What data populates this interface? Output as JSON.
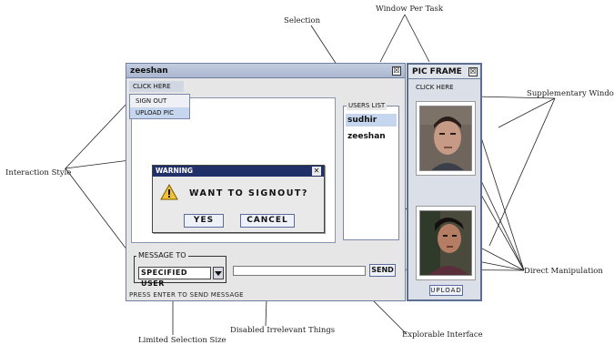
{
  "annotations": {
    "window_per_task": "Window Per Task",
    "selection": "Selection",
    "supplementary_windows": "Supplementary Windows",
    "interaction_style": "Interaction Style",
    "direct_manipulation": "Direct Manipulation",
    "limited_selection_size": "Limited Selection Size",
    "disabled_irrelevant_things": "Disabled Irrelevant Things",
    "explorable_interface": "Explorable Interface"
  },
  "main_window": {
    "title": "zeeshan",
    "close_glyph": "☒",
    "menu_label": "CLICK HERE",
    "menu_items": [
      "SIGN OUT",
      "UPLOAD PIC"
    ],
    "users_list_title": "USERS LIST",
    "users": [
      "sudhir",
      "zeeshan"
    ],
    "message_to_label": "MESSAGE TO",
    "recipient_select": "SPECIFIED USER",
    "send_label": "SEND",
    "status_text": "PRESS ENTER TO SEND MESSAGE"
  },
  "dialog": {
    "title": "WARNING",
    "close_glyph": "✕",
    "message": "WANT TO SIGNOUT?",
    "yes_label": "YES",
    "cancel_label": "CANCEL"
  },
  "pic_window": {
    "title": "PIC FRAME",
    "close_glyph": "☒",
    "menu_label": "CLICK HERE",
    "upload_label": "UPLOAD"
  },
  "colors": {
    "title_bar": "#aab7cf",
    "dialog_title": "#22306a",
    "selected_user": "#c6d6ee",
    "pic_frame_border": "#5d6e95"
  }
}
